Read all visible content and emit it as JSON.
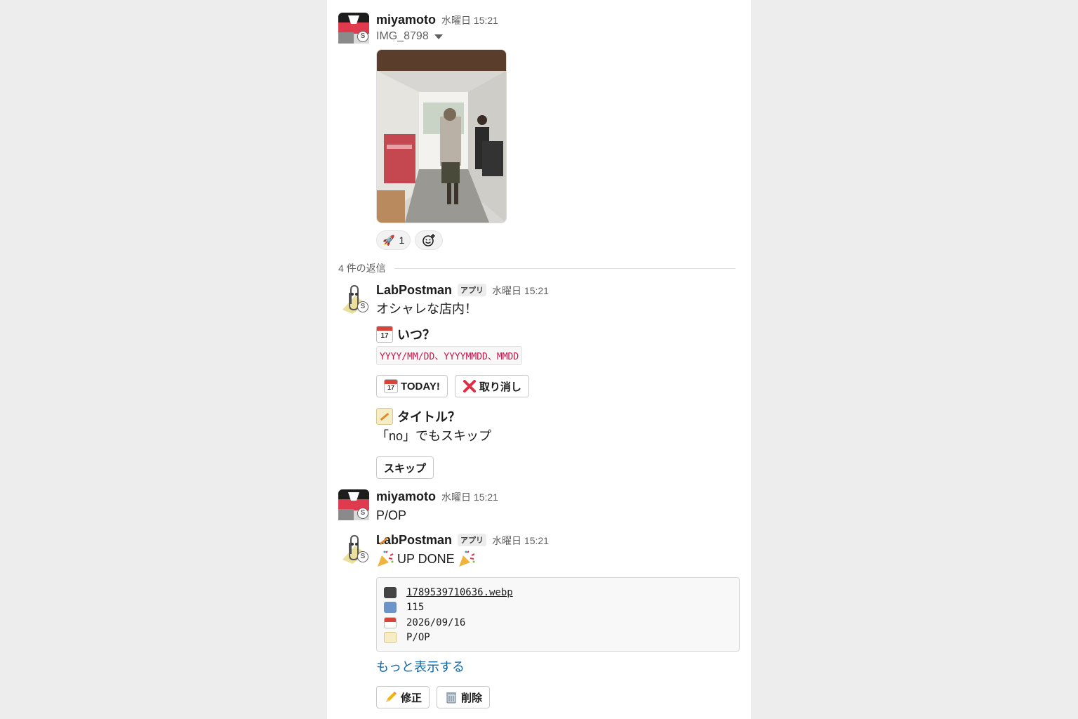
{
  "messages": {
    "first": {
      "author": "miyamoto",
      "time": "水曜日 15:21",
      "file_name": "IMG_8798",
      "reaction_emoji": "🚀",
      "reaction_count": "1"
    },
    "reply_count": "4 件の返信",
    "bot1": {
      "author": "LabPostman",
      "app_badge": "アプリ",
      "time": "水曜日 15:21",
      "text": "オシャレな店内！",
      "when_heading": "いつ？",
      "date_format": "YYYY/MM/DD、YYYYMMDD、MMDD",
      "today_button": "TODAY!",
      "cancel_button": "取り消し",
      "title_heading": "タイトル？",
      "skip_hint": "「no」でもスキップ",
      "skip_button": "スキップ"
    },
    "user2": {
      "author": "miyamoto",
      "time": "水曜日 15:21",
      "text": "P/OP"
    },
    "bot2": {
      "author": "LabPostman",
      "app_badge": "アプリ",
      "time": "水曜日 15:21",
      "text": "UP DONE",
      "attachment": {
        "file": "1789539710636.webp",
        "number": "115",
        "date": "2026/09/16",
        "title": "P/OP"
      },
      "show_more": "もっと表示する",
      "edit_button": "修正",
      "delete_button": "削除"
    }
  },
  "calendar_day": "17",
  "colors": {
    "link": "#1264a3",
    "code": "#c1194a",
    "background": "#ededed"
  }
}
